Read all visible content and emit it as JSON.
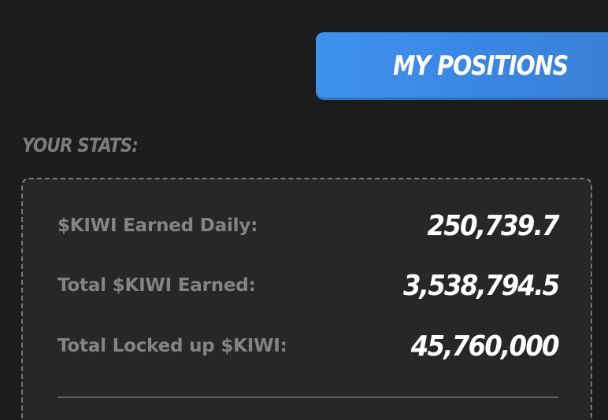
{
  "header": {
    "my_positions_label": "MY POSITIONS"
  },
  "stats": {
    "title": "YOUR STATS:",
    "rows": [
      {
        "label": "$KIWI Earned Daily:",
        "value": "250,739.7"
      },
      {
        "label": "Total $KIWI Earned:",
        "value": "3,538,794.5"
      },
      {
        "label": "Total Locked up $KIWI:",
        "value": "45,760,000"
      }
    ]
  },
  "colors": {
    "background": "#1c1c1c",
    "card": "#272727",
    "accent": "#3e92ee",
    "label": "#848484",
    "value": "#ffffff"
  }
}
